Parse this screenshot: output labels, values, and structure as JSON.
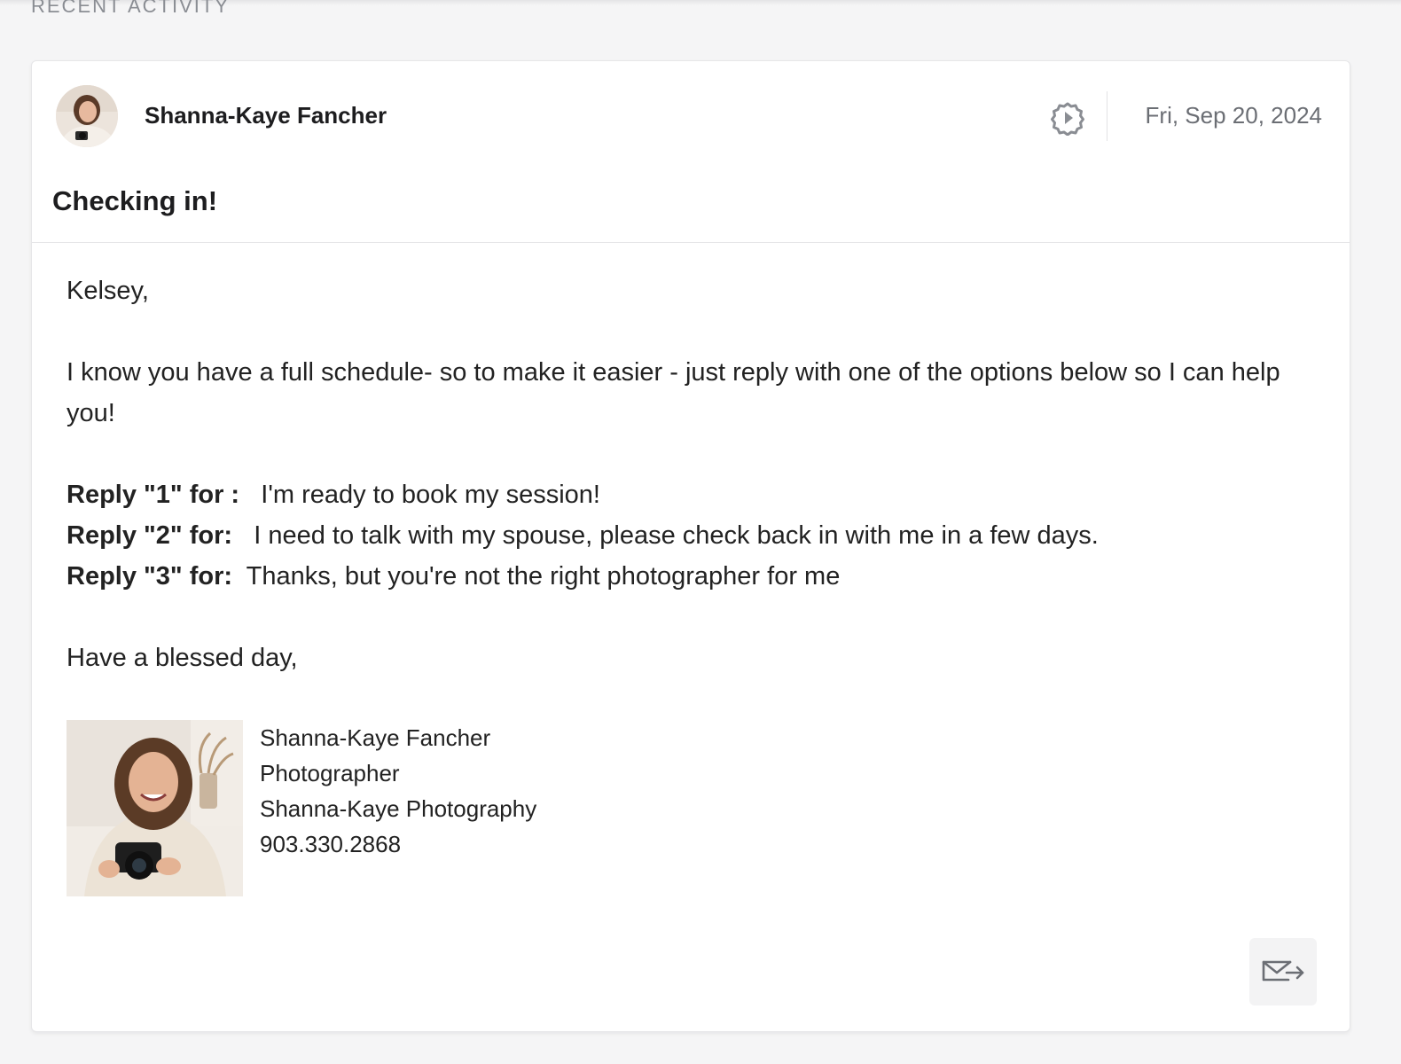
{
  "section": {
    "label": "RECENT ACTIVITY"
  },
  "message": {
    "sender_name": "Shanna-Kaye Fancher",
    "date": "Fri, Sep 20, 2024",
    "subject": "Checking in!",
    "greeting": "Kelsey,",
    "intro": "I know you have a full schedule- so to make it easier - just reply with one of the options below so I can help you!",
    "options": [
      {
        "label": "Reply \"1\" for :",
        "text": "I'm ready to book my session!"
      },
      {
        "label": "Reply \"2\" for:",
        "text": "I need to talk with my spouse, please check back in with me in a few days."
      },
      {
        "label": "Reply \"3\" for:",
        "text": "Thanks, but you're not the right photographer for me"
      }
    ],
    "closing": "Have a blessed day,",
    "signature": {
      "name": "Shanna-Kaye Fancher",
      "title": "Photographer",
      "company": "Shanna-Kaye Photography",
      "phone": "903.330.2868"
    }
  },
  "icons": {
    "settings": "gear-icon",
    "forward": "mail-forward-icon"
  },
  "colors": {
    "background": "#f5f5f6",
    "card": "#ffffff",
    "muted_text": "#6b6e74",
    "icon": "#8a8d93"
  }
}
